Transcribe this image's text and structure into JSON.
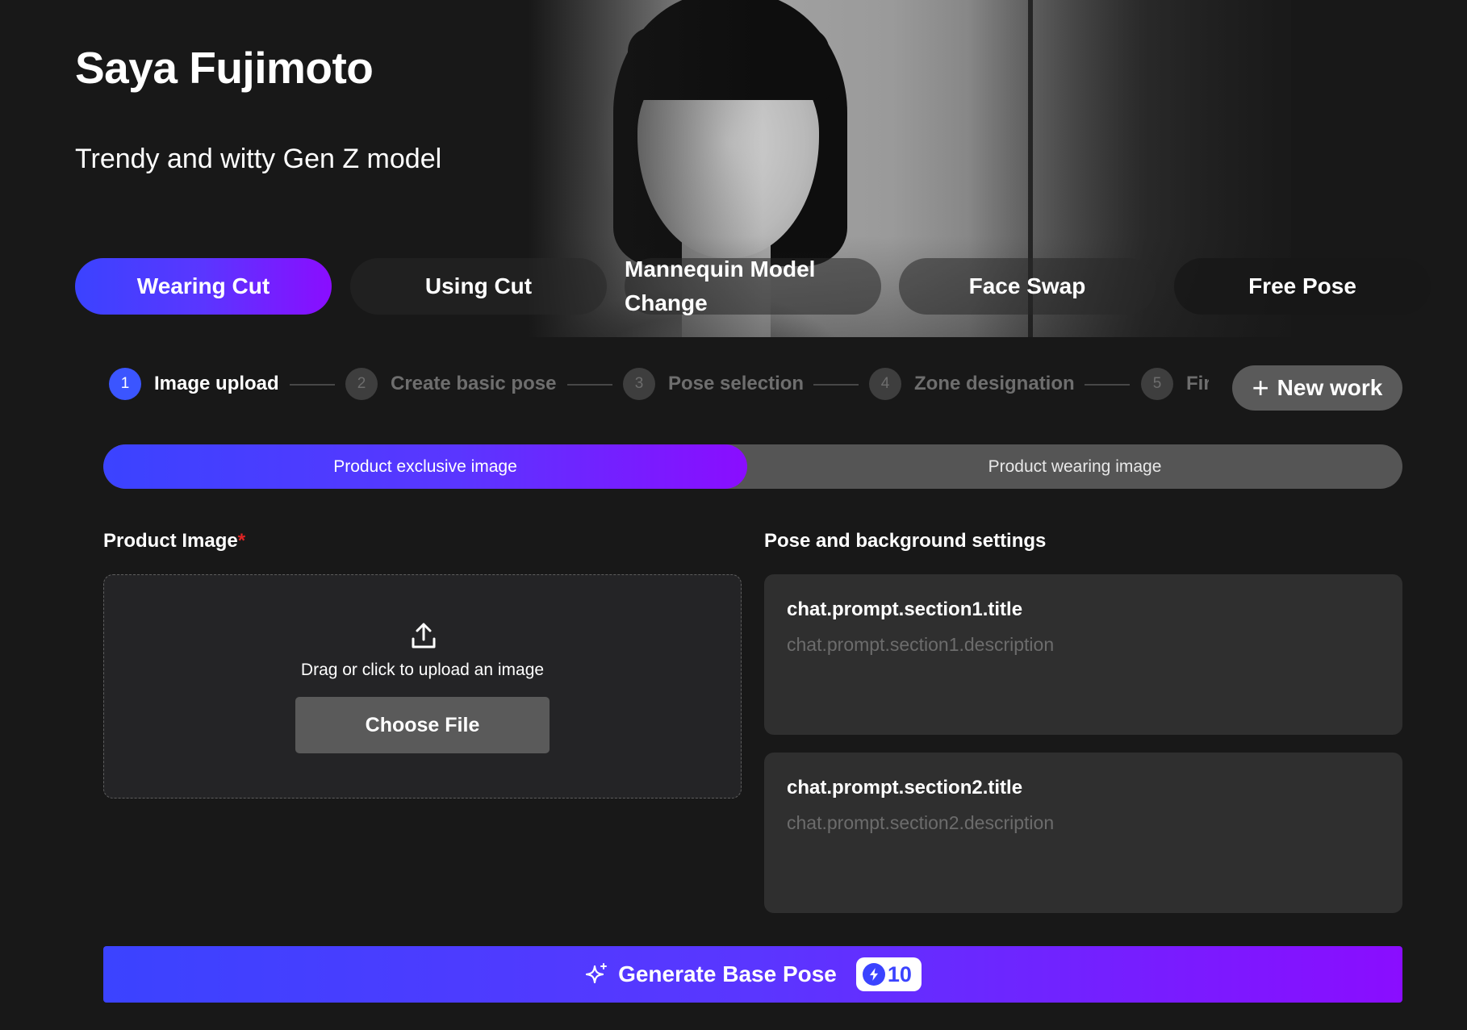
{
  "header": {
    "model_name": "Saya Fujimoto",
    "model_tagline": "Trendy and witty Gen Z model"
  },
  "tabs": [
    {
      "label": "Wearing Cut",
      "active": true
    },
    {
      "label": "Using Cut",
      "active": false
    },
    {
      "label": "Mannequin Model Change",
      "active": false
    },
    {
      "label": "Face Swap",
      "active": false
    },
    {
      "label": "Free Pose",
      "active": false
    }
  ],
  "stepper": {
    "steps": [
      {
        "number": "1",
        "label": "Image upload",
        "active": true
      },
      {
        "number": "2",
        "label": "Create basic pose",
        "active": false
      },
      {
        "number": "3",
        "label": "Pose selection",
        "active": false
      },
      {
        "number": "4",
        "label": "Zone designation",
        "active": false
      },
      {
        "number": "5",
        "label": "Fir",
        "active": false
      }
    ],
    "new_work_label": "New work"
  },
  "image_type": {
    "options": [
      "Product exclusive image",
      "Product wearing image"
    ],
    "selected": "Product exclusive image"
  },
  "product_image": {
    "label": "Product Image",
    "required_mark": "*",
    "upload_text": "Drag or click to upload an image",
    "choose_button": "Choose File"
  },
  "pose_settings": {
    "label": "Pose and background settings",
    "sections": [
      {
        "title": "chat.prompt.section1.title",
        "description": "chat.prompt.section1.description"
      },
      {
        "title": "chat.prompt.section2.title",
        "description": "chat.prompt.section2.description"
      }
    ]
  },
  "generate": {
    "label": "Generate Base Pose",
    "credits": "10"
  },
  "colors": {
    "background": "#181818",
    "accent_start": "#3b43ff",
    "accent_end": "#8a0dff",
    "required": "#e02424"
  }
}
